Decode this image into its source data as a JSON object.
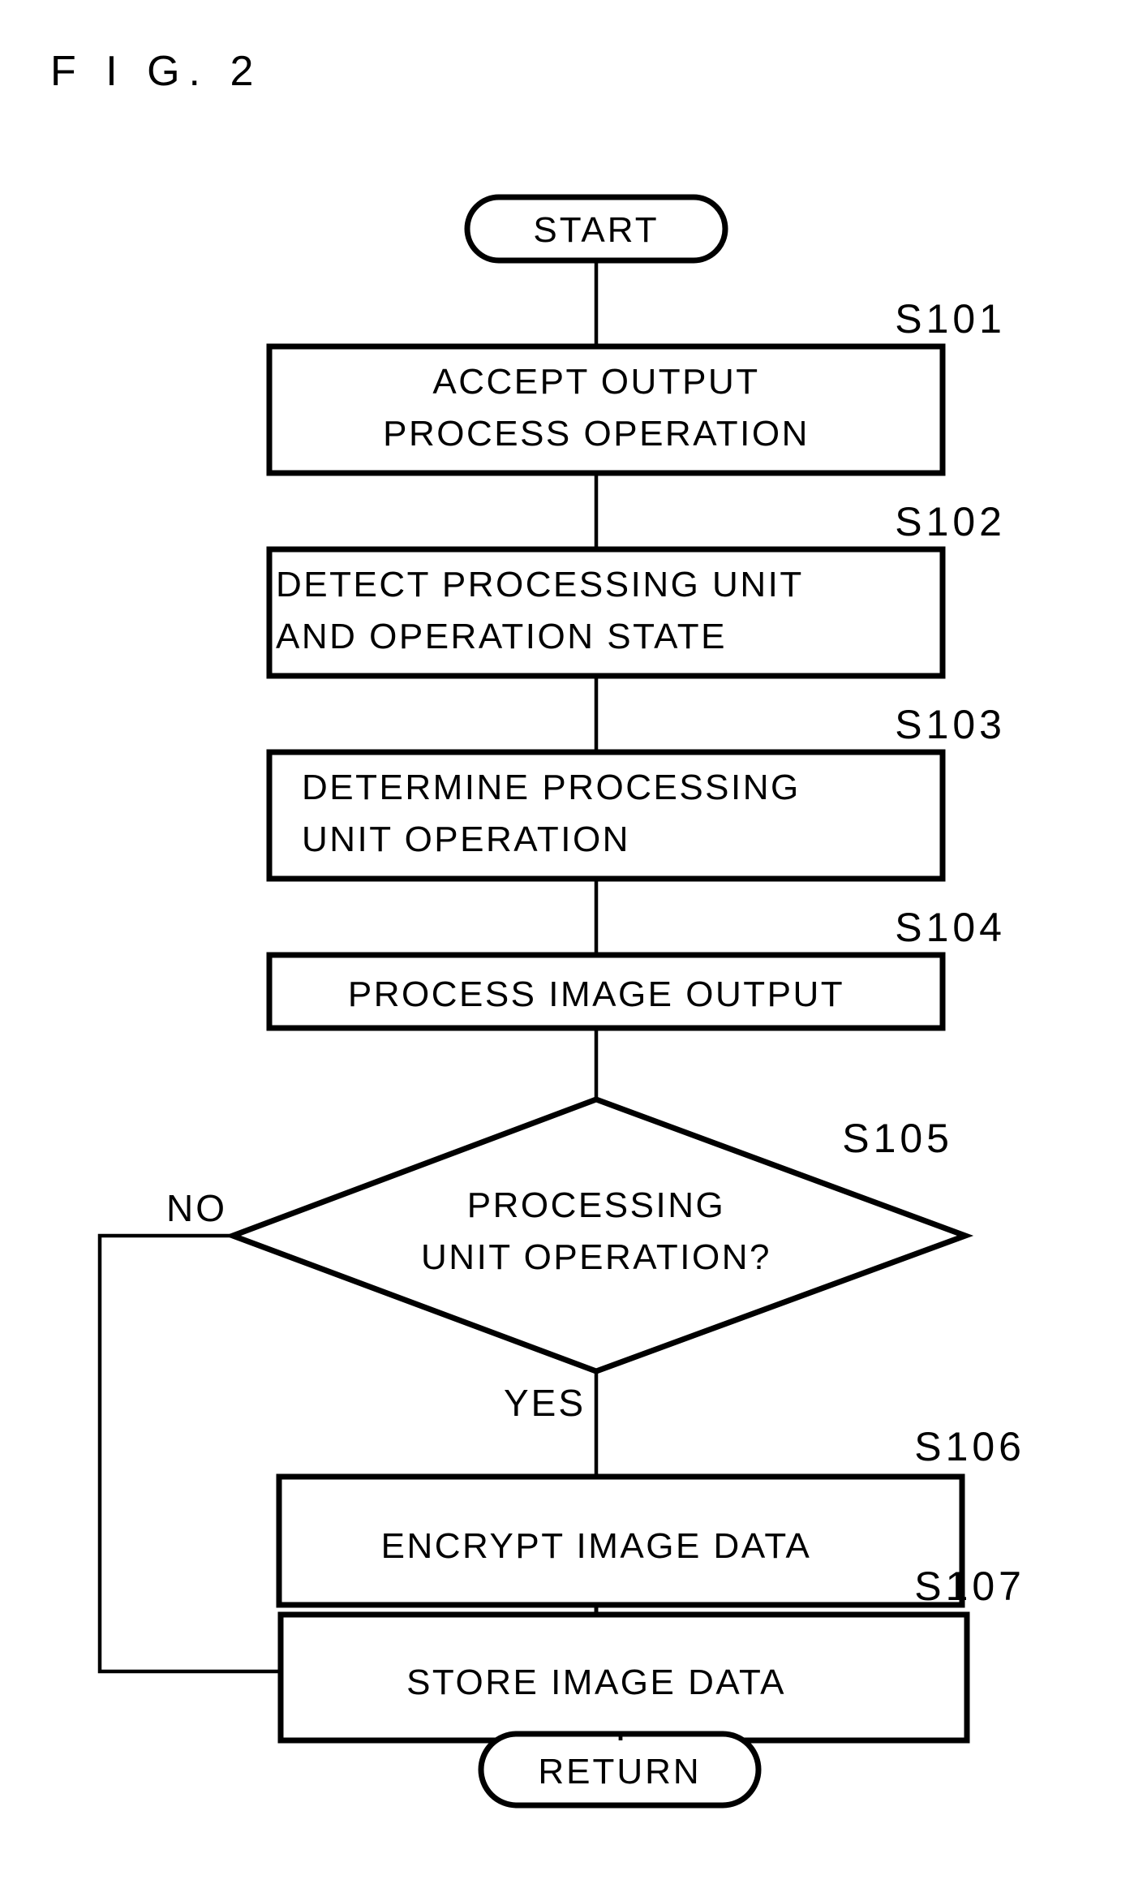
{
  "figure": {
    "title": "F I G.  2",
    "type": "flowchart"
  },
  "chart_data": {
    "type": "diagram",
    "title": "F I G. 2",
    "nodes": [
      {
        "id": "start",
        "kind": "terminal",
        "label": "START"
      },
      {
        "id": "s101",
        "kind": "process",
        "step": "S101",
        "label_line1": "ACCEPT OUTPUT",
        "label_line2": "PROCESS OPERATION"
      },
      {
        "id": "s102",
        "kind": "process",
        "step": "S102",
        "label_line1": "DETECT PROCESSING UNIT",
        "label_line2": "AND OPERATION STATE"
      },
      {
        "id": "s103",
        "kind": "process",
        "step": "S103",
        "label_line1": "DETERMINE PROCESSING",
        "label_line2": "UNIT OPERATION"
      },
      {
        "id": "s104",
        "kind": "process",
        "step": "S104",
        "label_line1": "PROCESS IMAGE OUTPUT"
      },
      {
        "id": "s105",
        "kind": "decision",
        "step": "S105",
        "label_line1": "PROCESSING",
        "label_line2": "UNIT OPERATION?"
      },
      {
        "id": "s106",
        "kind": "process",
        "step": "S106",
        "label_line1": "ENCRYPT IMAGE DATA"
      },
      {
        "id": "s107",
        "kind": "process",
        "step": "S107",
        "label_line1": "STORE IMAGE DATA"
      },
      {
        "id": "return",
        "kind": "terminal",
        "label": "RETURN"
      }
    ],
    "edges": [
      {
        "from": "start",
        "to": "s101",
        "label": ""
      },
      {
        "from": "s101",
        "to": "s102",
        "label": ""
      },
      {
        "from": "s102",
        "to": "s103",
        "label": ""
      },
      {
        "from": "s103",
        "to": "s104",
        "label": ""
      },
      {
        "from": "s104",
        "to": "s105",
        "label": ""
      },
      {
        "from": "s105",
        "to": "s106",
        "label": "YES"
      },
      {
        "from": "s105",
        "to": "s107",
        "label": "NO"
      },
      {
        "from": "s106",
        "to": "s107",
        "label": ""
      },
      {
        "from": "s107",
        "to": "return",
        "label": ""
      }
    ]
  },
  "terminals": {
    "start": "START",
    "end": "RETURN"
  },
  "steps": {
    "s101": {
      "id": "S101",
      "line1": "ACCEPT OUTPUT",
      "line2": "PROCESS OPERATION"
    },
    "s102": {
      "id": "S102",
      "line1": "DETECT PROCESSING UNIT",
      "line2": "AND OPERATION STATE"
    },
    "s103": {
      "id": "S103",
      "line1": "DETERMINE PROCESSING",
      "line2": "UNIT OPERATION"
    },
    "s104": {
      "id": "S104",
      "line1": "PROCESS IMAGE OUTPUT"
    },
    "s105": {
      "id": "S105",
      "line1": "PROCESSING",
      "line2": "UNIT OPERATION?"
    },
    "s106": {
      "id": "S106",
      "line1": "ENCRYPT IMAGE DATA"
    },
    "s107": {
      "id": "S107",
      "line1": "STORE IMAGE DATA"
    }
  },
  "branches": {
    "no": "NO",
    "yes": "YES"
  },
  "colors": {
    "ink": "#000000",
    "paper": "#ffffff"
  }
}
